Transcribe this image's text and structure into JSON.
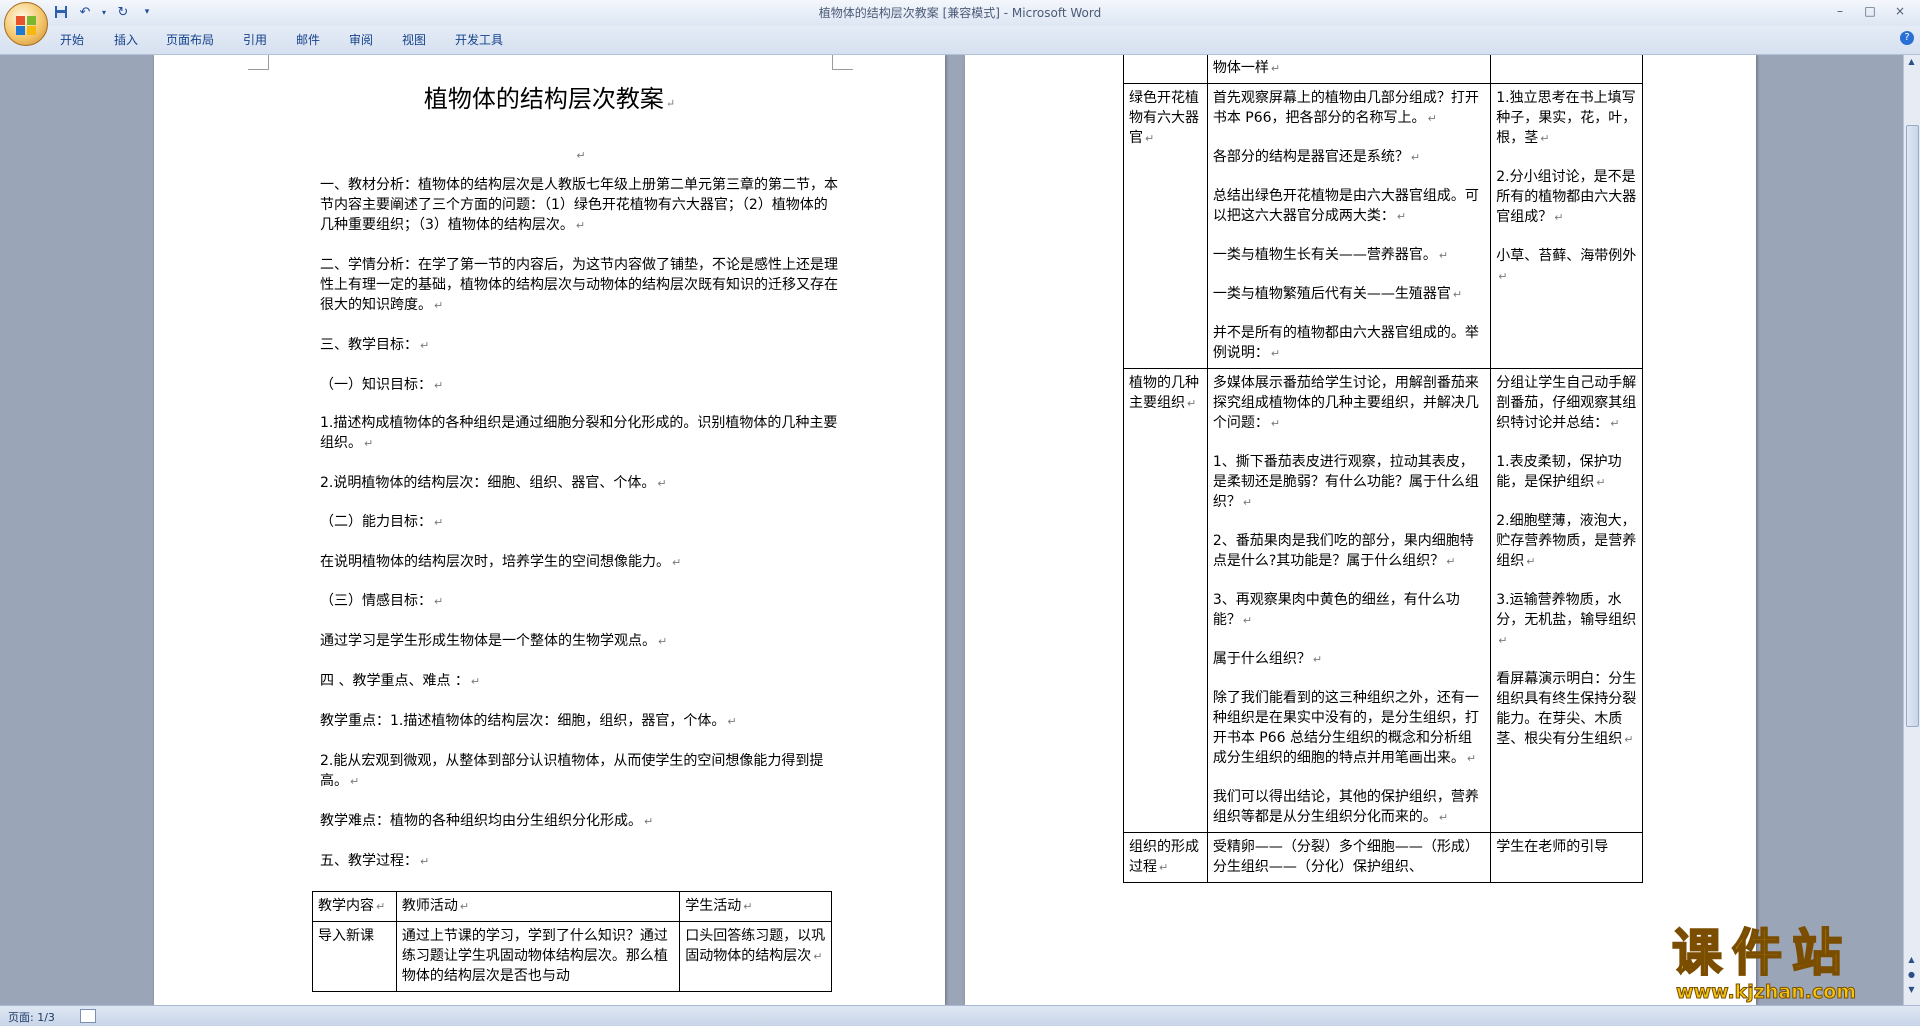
{
  "window": {
    "title": "植物体的结构层次教案 [兼容模式] - Microsoft Word",
    "controls": [
      "–",
      "□",
      "×"
    ]
  },
  "quick_access": {
    "save_icon": "floppy-disk-icon",
    "undo_icon": "undo-icon",
    "redo_icon": "redo-icon",
    "customize_icon": "dropdown-icon"
  },
  "ribbon_tabs": [
    "开始",
    "插入",
    "页面布局",
    "引用",
    "邮件",
    "审阅",
    "视图",
    "开发工具"
  ],
  "page1": {
    "title": "植物体的结构层次教案",
    "paragraphs": [
      "一、教材分析：植物体的结构层次是人教版七年级上册第二单元第三章的第二节，本节内容主要阐述了三个方面的问题：（1）绿色开花植物有六大器官；（2）植物体的几种重要组织；（3）植物体的结构层次。",
      "二、学情分析：在学了第一节的内容后，为这节内容做了铺垫，不论是感性上还是理性上有理一定的基础，植物体的结构层次与动物体的结构层次既有知识的迁移又存在很大的知识跨度。",
      "三、教学目标：",
      "（一）知识目标：",
      "1.描述构成植物体的各种组织是通过细胞分裂和分化形成的。识别植物体的几种主要组织。",
      "2.说明植物体的结构层次：细胞、组织、器官、个体。",
      "（二）能力目标：",
      "在说明植物体的结构层次时，培养学生的空间想像能力。",
      "（三）情感目标：",
      "通过学习是学生形成生物体是一个整体的生物学观点。",
      "四 、教学重点、难点 ：",
      "教学重点：1.描述植物体的结构层次：细胞，组织，器官，个体。",
      "2.能从宏观到微观，从整体到部分认识植物体，从而使学生的空间想像能力得到提高。",
      "教学难点：植物的各种组织均由分生组织分化形成。",
      "五、教学过程："
    ],
    "table": {
      "headers": [
        "教学内容",
        "教师活动",
        "学生活动"
      ],
      "rows": [
        [
          "导入新课",
          "通过上节课的学习，学到了什么知识？通过练习题让学生巩固动物体结构层次。那么植物体的结构层次是否也与动",
          "口头回答练习题，以巩固动物体的结构层次"
        ]
      ]
    }
  },
  "page2": {
    "table": {
      "row0_teacher": "物体一样",
      "rows": [
        {
          "content": "绿色开花植物有六大器官",
          "teacher": [
            "首先观察屏幕上的植物由几部分组成？打开书本 P66，把各部分的名称写上。",
            "各部分的结构是器官还是系统？",
            "总结出绿色开花植物是由六大器官组成。可以把这六大器官分成两大类：",
            "一类与植物生长有关——营养器官。",
            "一类与植物繁殖后代有关——生殖器官",
            "并不是所有的植物都由六大器官组成的。举例说明："
          ],
          "student": [
            "1.独立思考在书上填写种子，果实，花，叶，根，茎",
            "2.分小组讨论，是不是所有的植物都由六大器官组成？",
            "小草、苔藓、海带例外"
          ]
        },
        {
          "content": "植物的几种主要组织",
          "teacher": [
            "多媒体展示番茄给学生讨论，用解剖番茄来探究组成植物体的几种主要组织，并解决几个问题：",
            "1、撕下番茄表皮进行观察，拉动其表皮，是柔韧还是脆弱？有什么功能？属于什么组织？",
            "2、番茄果肉是我们吃的部分，果内细胞特点是什么?其功能是？属于什么组织？",
            "3、再观察果肉中黄色的细丝，有什么功能？",
            "属于什么组织？",
            "除了我们能看到的这三种组织之外，还有一种组织是在果实中没有的，是分生组织，打开书本 P66 总结分生组织的概念和分析组成分生组织的细胞的特点并用笔画出来。",
            "我们可以得出结论，其他的保护组织，营养组织等都是从分生组织分化而来的。"
          ],
          "student": [
            "分组让学生自己动手解剖番茄，仔细观察其组织特讨论并总结：",
            "1.表皮柔韧，保护功能，是保护组织",
            "2.细胞壁薄，液泡大，贮存营养物质，是营养组织",
            "3.运输营养物质，水分，无机盐，输导组织",
            "看屏幕演示明白：分生组织具有终生保持分裂能力。在芽尖、木质茎、根尖有分生组织"
          ]
        },
        {
          "content": "组织的形成过程",
          "teacher": [
            "受精卵——（分裂）多个细胞——（形成）分生组织——（分化）保护组织、"
          ],
          "student": [
            "学生在老师的引导"
          ]
        }
      ]
    }
  },
  "status": {
    "page_indicator": "页面: 1/3"
  },
  "watermark": {
    "main": "课件站",
    "url": "www.kjzhan.com"
  },
  "colors": {
    "ribbon_text": "#15428b",
    "workspace": "#9aa5b7",
    "watermark_fill": "#f2c510"
  }
}
